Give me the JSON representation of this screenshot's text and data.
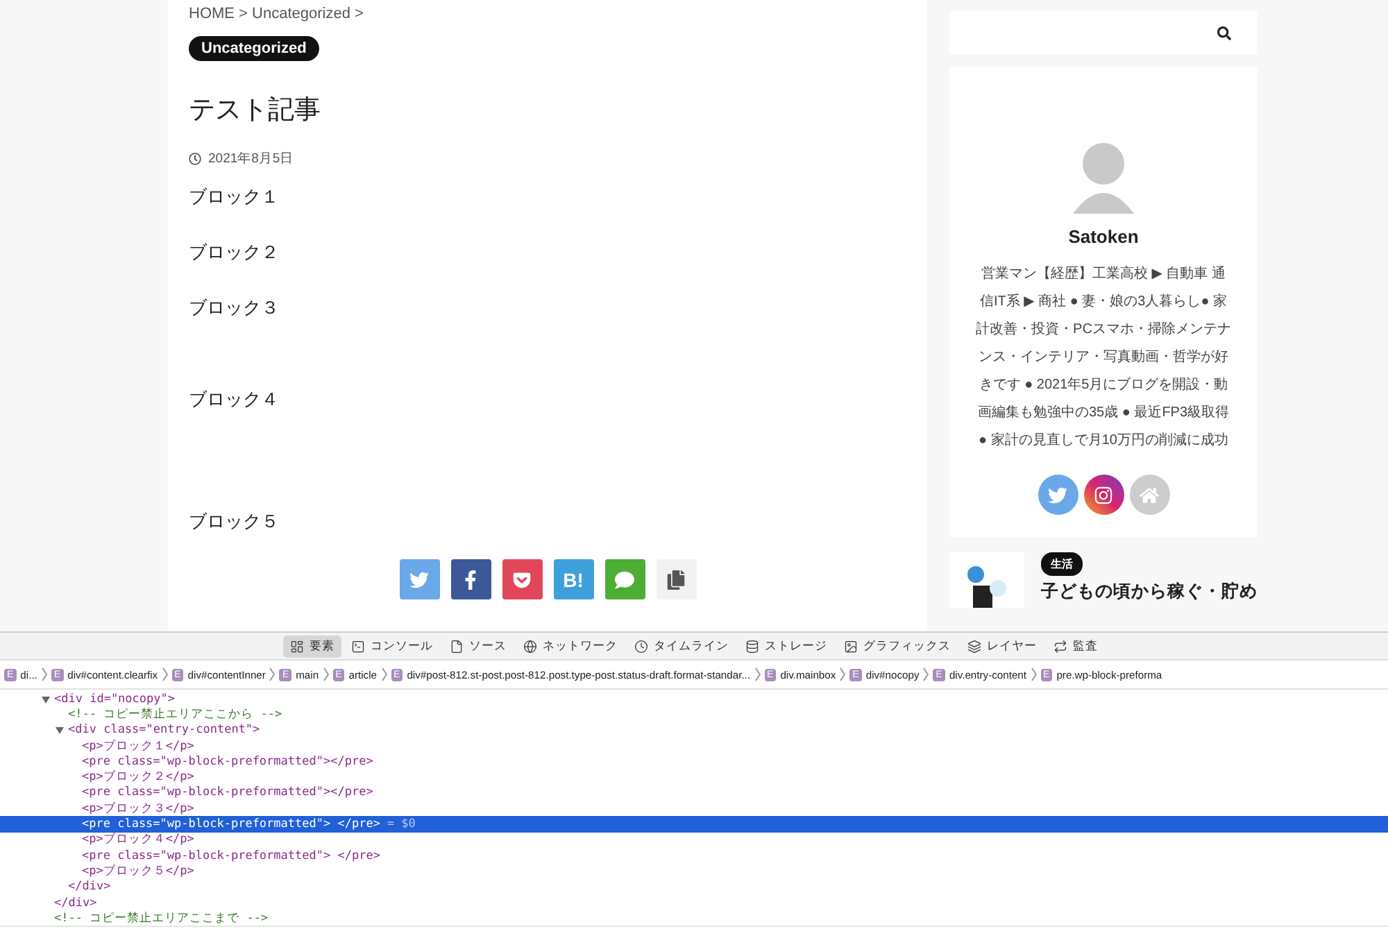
{
  "page": {
    "breadcrumb": "HOME > Uncategorized >",
    "category": "Uncategorized",
    "title": "テスト記事",
    "date": "2021年8月5日",
    "blocks": [
      {
        "kind": "p",
        "text": "ブロック１"
      },
      {
        "kind": "p",
        "text": "ブロック２"
      },
      {
        "kind": "p",
        "text": "ブロック３"
      },
      {
        "kind": "p",
        "text": "ブロック４"
      },
      {
        "kind": "p",
        "text": "ブロック５"
      }
    ],
    "share": [
      {
        "kind": "twitter"
      },
      {
        "kind": "facebook"
      },
      {
        "kind": "pocket"
      },
      {
        "kind": "hatena",
        "label": "B!"
      },
      {
        "kind": "line"
      },
      {
        "kind": "copy"
      }
    ]
  },
  "sidebar": {
    "profile": {
      "name": "Satoken",
      "bio": "営業マン【経歴】工業高校 ▶ 自動車 通信IT系 ▶ 商社 ● 妻・娘の3人暮らし● 家計改善・投資・PCスマホ・掃除メンテナンス・インテリア・写真動画・哲学が好きです ● 2021年5月にブログを開設・動画編集も勉強中の35歳 ● 最近FP3級取得 ● 家計の見直しで月10万円の削減に成功",
      "links": [
        {
          "kind": "twitter"
        },
        {
          "kind": "instagram"
        },
        {
          "kind": "home"
        }
      ]
    },
    "post": {
      "tag": "生活",
      "title": "子どもの頃から稼ぐ・貯め"
    }
  },
  "devtools": {
    "tabs": [
      {
        "label": "要素",
        "kind": "elements",
        "selected": true
      },
      {
        "label": "コンソール",
        "kind": "console",
        "selected": false
      },
      {
        "label": "ソース",
        "kind": "sources",
        "selected": false
      },
      {
        "label": "ネットワーク",
        "kind": "network",
        "selected": false
      },
      {
        "label": "タイムライン",
        "kind": "timeline",
        "selected": false
      },
      {
        "label": "ストレージ",
        "kind": "storage",
        "selected": false
      },
      {
        "label": "グラフィックス",
        "kind": "graphics",
        "selected": false
      },
      {
        "label": "レイヤー",
        "kind": "layers",
        "selected": false
      },
      {
        "label": "監査",
        "kind": "audit",
        "selected": false
      }
    ],
    "path": [
      {
        "badge": "E",
        "label": "di..."
      },
      {
        "badge": "E",
        "label": "div#content.clearfix"
      },
      {
        "badge": "E",
        "label": "div#contentInner"
      },
      {
        "badge": "E",
        "label": "main"
      },
      {
        "badge": "E",
        "label": "article"
      },
      {
        "badge": "E",
        "label": "div#post-812.st-post.post-812.post.type-post.status-draft.format-standar..."
      },
      {
        "badge": "E",
        "label": "div.mainbox"
      },
      {
        "badge": "E",
        "label": "div#nocopy"
      },
      {
        "badge": "E",
        "label": "div.entry-content"
      },
      {
        "badge": "E",
        "label": "pre.wp-block-preforma"
      }
    ],
    "tree": [
      {
        "kind": "element",
        "text": "<div id=\"nocopy\">",
        "expanded": true,
        "selected": false,
        "children": [
          {
            "kind": "comment",
            "text": "<!-- コピー禁止エリアここから -->",
            "selected": false
          },
          {
            "kind": "element",
            "text": "<div class=\"entry-content\">",
            "expanded": true,
            "selected": false,
            "children": [
              {
                "kind": "element",
                "text": "<p>ブロック１</p>",
                "selected": false
              },
              {
                "kind": "element",
                "text": "<pre class=\"wp-block-preformatted\"></pre>",
                "selected": false
              },
              {
                "kind": "element",
                "text": "<p>ブロック２</p>",
                "selected": false
              },
              {
                "kind": "element",
                "text": "<pre class=\"wp-block-preformatted\"></pre>",
                "selected": false
              },
              {
                "kind": "element",
                "text": "<p>ブロック３</p>",
                "selected": false
              },
              {
                "kind": "element",
                "text": "<pre class=\"wp-block-preformatted\"> </pre>",
                "selected": true,
                "suffix": "= $0"
              },
              {
                "kind": "element",
                "text": "<p>ブロック４</p>",
                "selected": false
              },
              {
                "kind": "element",
                "text": "<pre class=\"wp-block-preformatted\"> </pre>",
                "selected": false
              },
              {
                "kind": "element",
                "text": "<p>ブロック５</p>",
                "selected": false
              }
            ]
          },
          {
            "kind": "element",
            "text": "</div>",
            "selected": false
          }
        ]
      },
      {
        "kind": "element",
        "text": "</div>",
        "selected": false
      },
      {
        "kind": "comment",
        "text": "<!-- コピー禁止エリアここまで -->",
        "selected": false
      }
    ]
  }
}
